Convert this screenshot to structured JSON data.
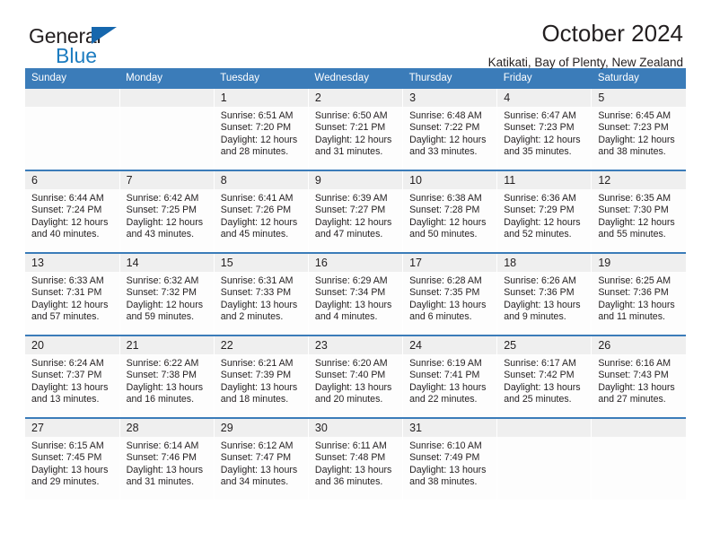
{
  "branding": {
    "logo_text_top": "General",
    "logo_text_bottom": "Blue",
    "logo_color_dark": "#231f20",
    "logo_color_blue": "#1c7cc0",
    "triangle_color": "#1667ad"
  },
  "header": {
    "title": "October 2024",
    "subtitle": "Katikati, Bay of Plenty, New Zealand"
  },
  "theme": {
    "header_blue": "#3b7cb9",
    "daynum_band": "#efefef",
    "cell_bg": "#fdfdfd",
    "text": "#231f20"
  },
  "weekday_headers": [
    "Sunday",
    "Monday",
    "Tuesday",
    "Wednesday",
    "Thursday",
    "Friday",
    "Saturday"
  ],
  "labels": {
    "sunrise_prefix": "Sunrise:",
    "sunset_prefix": "Sunset:",
    "daylight_prefix": "Daylight:"
  },
  "weeks": [
    [
      {
        "day": "",
        "empty": true
      },
      {
        "day": "",
        "empty": true
      },
      {
        "day": "1",
        "sunrise": "Sunrise: 6:51 AM",
        "sunset": "Sunset: 7:20 PM",
        "daylight_1": "Daylight: 12 hours",
        "daylight_2": "and 28 minutes."
      },
      {
        "day": "2",
        "sunrise": "Sunrise: 6:50 AM",
        "sunset": "Sunset: 7:21 PM",
        "daylight_1": "Daylight: 12 hours",
        "daylight_2": "and 31 minutes."
      },
      {
        "day": "3",
        "sunrise": "Sunrise: 6:48 AM",
        "sunset": "Sunset: 7:22 PM",
        "daylight_1": "Daylight: 12 hours",
        "daylight_2": "and 33 minutes."
      },
      {
        "day": "4",
        "sunrise": "Sunrise: 6:47 AM",
        "sunset": "Sunset: 7:23 PM",
        "daylight_1": "Daylight: 12 hours",
        "daylight_2": "and 35 minutes."
      },
      {
        "day": "5",
        "sunrise": "Sunrise: 6:45 AM",
        "sunset": "Sunset: 7:23 PM",
        "daylight_1": "Daylight: 12 hours",
        "daylight_2": "and 38 minutes."
      }
    ],
    [
      {
        "day": "6",
        "sunrise": "Sunrise: 6:44 AM",
        "sunset": "Sunset: 7:24 PM",
        "daylight_1": "Daylight: 12 hours",
        "daylight_2": "and 40 minutes."
      },
      {
        "day": "7",
        "sunrise": "Sunrise: 6:42 AM",
        "sunset": "Sunset: 7:25 PM",
        "daylight_1": "Daylight: 12 hours",
        "daylight_2": "and 43 minutes."
      },
      {
        "day": "8",
        "sunrise": "Sunrise: 6:41 AM",
        "sunset": "Sunset: 7:26 PM",
        "daylight_1": "Daylight: 12 hours",
        "daylight_2": "and 45 minutes."
      },
      {
        "day": "9",
        "sunrise": "Sunrise: 6:39 AM",
        "sunset": "Sunset: 7:27 PM",
        "daylight_1": "Daylight: 12 hours",
        "daylight_2": "and 47 minutes."
      },
      {
        "day": "10",
        "sunrise": "Sunrise: 6:38 AM",
        "sunset": "Sunset: 7:28 PM",
        "daylight_1": "Daylight: 12 hours",
        "daylight_2": "and 50 minutes."
      },
      {
        "day": "11",
        "sunrise": "Sunrise: 6:36 AM",
        "sunset": "Sunset: 7:29 PM",
        "daylight_1": "Daylight: 12 hours",
        "daylight_2": "and 52 minutes."
      },
      {
        "day": "12",
        "sunrise": "Sunrise: 6:35 AM",
        "sunset": "Sunset: 7:30 PM",
        "daylight_1": "Daylight: 12 hours",
        "daylight_2": "and 55 minutes."
      }
    ],
    [
      {
        "day": "13",
        "sunrise": "Sunrise: 6:33 AM",
        "sunset": "Sunset: 7:31 PM",
        "daylight_1": "Daylight: 12 hours",
        "daylight_2": "and 57 minutes."
      },
      {
        "day": "14",
        "sunrise": "Sunrise: 6:32 AM",
        "sunset": "Sunset: 7:32 PM",
        "daylight_1": "Daylight: 12 hours",
        "daylight_2": "and 59 minutes."
      },
      {
        "day": "15",
        "sunrise": "Sunrise: 6:31 AM",
        "sunset": "Sunset: 7:33 PM",
        "daylight_1": "Daylight: 13 hours",
        "daylight_2": "and 2 minutes."
      },
      {
        "day": "16",
        "sunrise": "Sunrise: 6:29 AM",
        "sunset": "Sunset: 7:34 PM",
        "daylight_1": "Daylight: 13 hours",
        "daylight_2": "and 4 minutes."
      },
      {
        "day": "17",
        "sunrise": "Sunrise: 6:28 AM",
        "sunset": "Sunset: 7:35 PM",
        "daylight_1": "Daylight: 13 hours",
        "daylight_2": "and 6 minutes."
      },
      {
        "day": "18",
        "sunrise": "Sunrise: 6:26 AM",
        "sunset": "Sunset: 7:36 PM",
        "daylight_1": "Daylight: 13 hours",
        "daylight_2": "and 9 minutes."
      },
      {
        "day": "19",
        "sunrise": "Sunrise: 6:25 AM",
        "sunset": "Sunset: 7:36 PM",
        "daylight_1": "Daylight: 13 hours",
        "daylight_2": "and 11 minutes."
      }
    ],
    [
      {
        "day": "20",
        "sunrise": "Sunrise: 6:24 AM",
        "sunset": "Sunset: 7:37 PM",
        "daylight_1": "Daylight: 13 hours",
        "daylight_2": "and 13 minutes."
      },
      {
        "day": "21",
        "sunrise": "Sunrise: 6:22 AM",
        "sunset": "Sunset: 7:38 PM",
        "daylight_1": "Daylight: 13 hours",
        "daylight_2": "and 16 minutes."
      },
      {
        "day": "22",
        "sunrise": "Sunrise: 6:21 AM",
        "sunset": "Sunset: 7:39 PM",
        "daylight_1": "Daylight: 13 hours",
        "daylight_2": "and 18 minutes."
      },
      {
        "day": "23",
        "sunrise": "Sunrise: 6:20 AM",
        "sunset": "Sunset: 7:40 PM",
        "daylight_1": "Daylight: 13 hours",
        "daylight_2": "and 20 minutes."
      },
      {
        "day": "24",
        "sunrise": "Sunrise: 6:19 AM",
        "sunset": "Sunset: 7:41 PM",
        "daylight_1": "Daylight: 13 hours",
        "daylight_2": "and 22 minutes."
      },
      {
        "day": "25",
        "sunrise": "Sunrise: 6:17 AM",
        "sunset": "Sunset: 7:42 PM",
        "daylight_1": "Daylight: 13 hours",
        "daylight_2": "and 25 minutes."
      },
      {
        "day": "26",
        "sunrise": "Sunrise: 6:16 AM",
        "sunset": "Sunset: 7:43 PM",
        "daylight_1": "Daylight: 13 hours",
        "daylight_2": "and 27 minutes."
      }
    ],
    [
      {
        "day": "27",
        "sunrise": "Sunrise: 6:15 AM",
        "sunset": "Sunset: 7:45 PM",
        "daylight_1": "Daylight: 13 hours",
        "daylight_2": "and 29 minutes."
      },
      {
        "day": "28",
        "sunrise": "Sunrise: 6:14 AM",
        "sunset": "Sunset: 7:46 PM",
        "daylight_1": "Daylight: 13 hours",
        "daylight_2": "and 31 minutes."
      },
      {
        "day": "29",
        "sunrise": "Sunrise: 6:12 AM",
        "sunset": "Sunset: 7:47 PM",
        "daylight_1": "Daylight: 13 hours",
        "daylight_2": "and 34 minutes."
      },
      {
        "day": "30",
        "sunrise": "Sunrise: 6:11 AM",
        "sunset": "Sunset: 7:48 PM",
        "daylight_1": "Daylight: 13 hours",
        "daylight_2": "and 36 minutes."
      },
      {
        "day": "31",
        "sunrise": "Sunrise: 6:10 AM",
        "sunset": "Sunset: 7:49 PM",
        "daylight_1": "Daylight: 13 hours",
        "daylight_2": "and 38 minutes."
      },
      {
        "day": "",
        "empty": true
      },
      {
        "day": "",
        "empty": true
      }
    ]
  ]
}
